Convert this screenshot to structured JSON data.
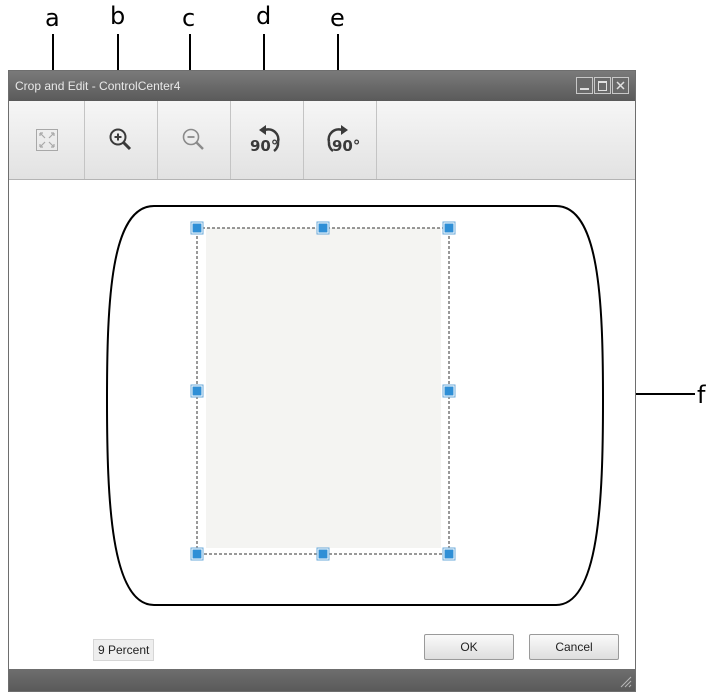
{
  "callouts": {
    "a": "a",
    "b": "b",
    "c": "c",
    "d": "d",
    "e": "e",
    "f": "f"
  },
  "window": {
    "title": "Crop and Edit - ControlCenter4"
  },
  "toolbar": {
    "fit_icon": "fit-to-window-icon",
    "zoom_in_icon": "zoom-in-icon",
    "zoom_out_icon": "zoom-out-icon",
    "rotate_left_label": "90°",
    "rotate_right_label": "90°"
  },
  "status": {
    "zoom_percent": "9 Percent"
  },
  "buttons": {
    "ok": "OK",
    "cancel": "Cancel"
  },
  "colors": {
    "handle": "#2f8fd6",
    "titlebar": "#6a6a6a"
  }
}
